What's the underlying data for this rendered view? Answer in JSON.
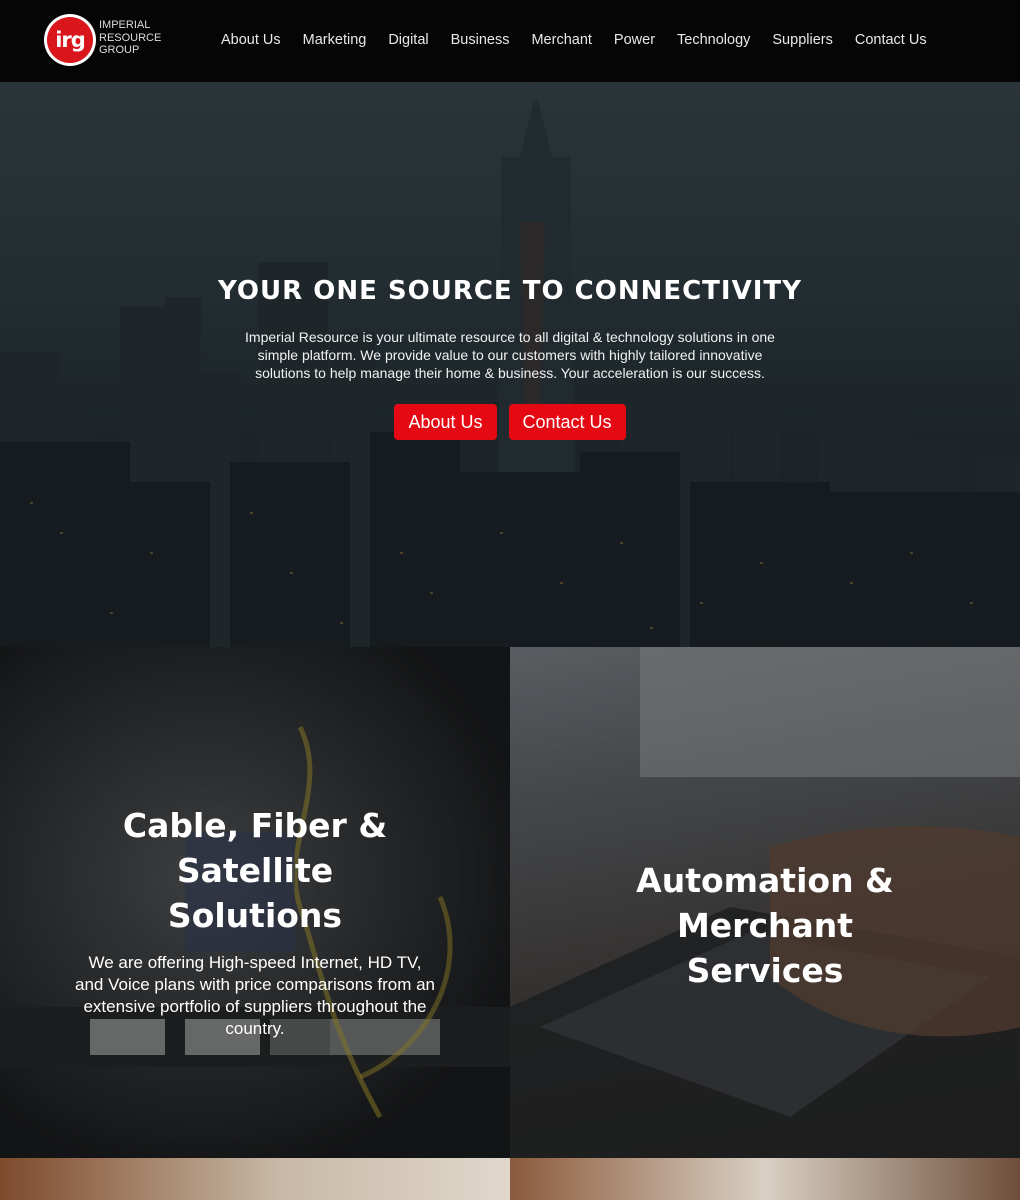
{
  "brand": {
    "badge_text": "irg",
    "name_lines": [
      "Imperial",
      "Resource",
      "Group"
    ],
    "badge_color": "#d8161b"
  },
  "nav": {
    "items": [
      {
        "label": "About Us"
      },
      {
        "label": "Marketing"
      },
      {
        "label": "Digital"
      },
      {
        "label": "Business"
      },
      {
        "label": "Merchant"
      },
      {
        "label": "Power"
      },
      {
        "label": "Technology"
      },
      {
        "label": "Suppliers"
      },
      {
        "label": "Contact Us"
      }
    ]
  },
  "hero": {
    "title": "YOUR ONE SOURCE TO CONNECTIVITY",
    "description": "Imperial Resource is your ultimate resource to all digital & technology solutions in one simple platform. We provide value to our customers with highly tailored innovative solutions to help manage their home & business. Your acceleration is our success.",
    "buttons": {
      "about_label": "About Us",
      "contact_label": "Contact Us"
    },
    "button_color": "#e50914"
  },
  "services": [
    {
      "title": "Cable, Fiber & Satellite Solutions",
      "description": "We are offering High-speed Internet, HD TV, and Voice plans with price comparisons from an extensive portfolio of suppliers throughout the country."
    },
    {
      "title": "Automation & Merchant Services",
      "description": ""
    }
  ]
}
